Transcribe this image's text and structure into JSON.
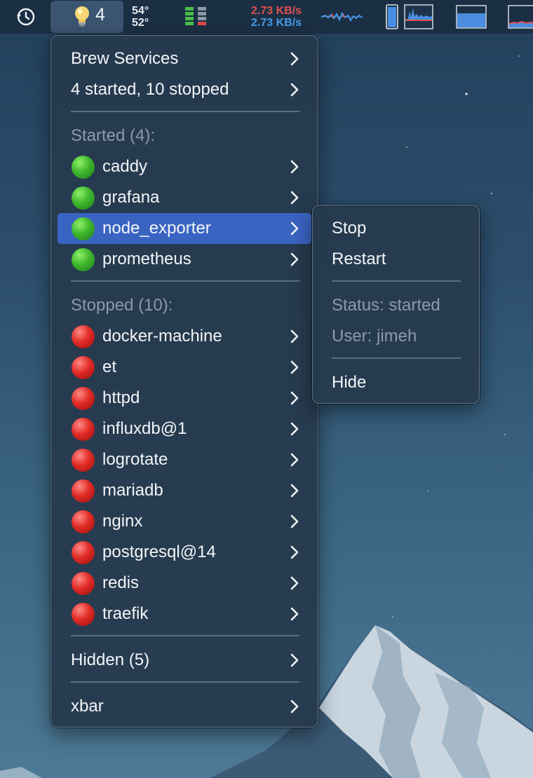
{
  "menubar": {
    "xbar_count": "4",
    "temp_high": "54°",
    "temp_low": "52°",
    "net_up": "2.73 KB/s",
    "net_down": "2.73 KB/s",
    "icons": [
      "history-icon",
      "lightbulb-icon",
      "battery-icon",
      "network-graph-icon",
      "cpu-icon",
      "memory-icon",
      "disk-icon"
    ]
  },
  "main_menu": {
    "title": "Brew Services",
    "summary": "4 started, 10 stopped",
    "started_header": "Started (4):",
    "started": [
      "caddy",
      "grafana",
      "node_exporter",
      "prometheus"
    ],
    "stopped_header": "Stopped (10):",
    "stopped": [
      "docker-machine",
      "et",
      "httpd",
      "influxdb@1",
      "logrotate",
      "mariadb",
      "nginx",
      "postgresql@14",
      "redis",
      "traefik"
    ],
    "hidden": "Hidden (5)",
    "xbar": "xbar",
    "highlighted": "node_exporter"
  },
  "sub_menu": {
    "stop": "Stop",
    "restart": "Restart",
    "status": "Status: started",
    "user": "User: jimeh",
    "hide": "Hide"
  },
  "colors": {
    "highlight": "#3a64c2",
    "started": "#3fb62d",
    "stopped": "#e12b26",
    "net_up": "#e05050",
    "net_down": "#4a9ae8"
  }
}
